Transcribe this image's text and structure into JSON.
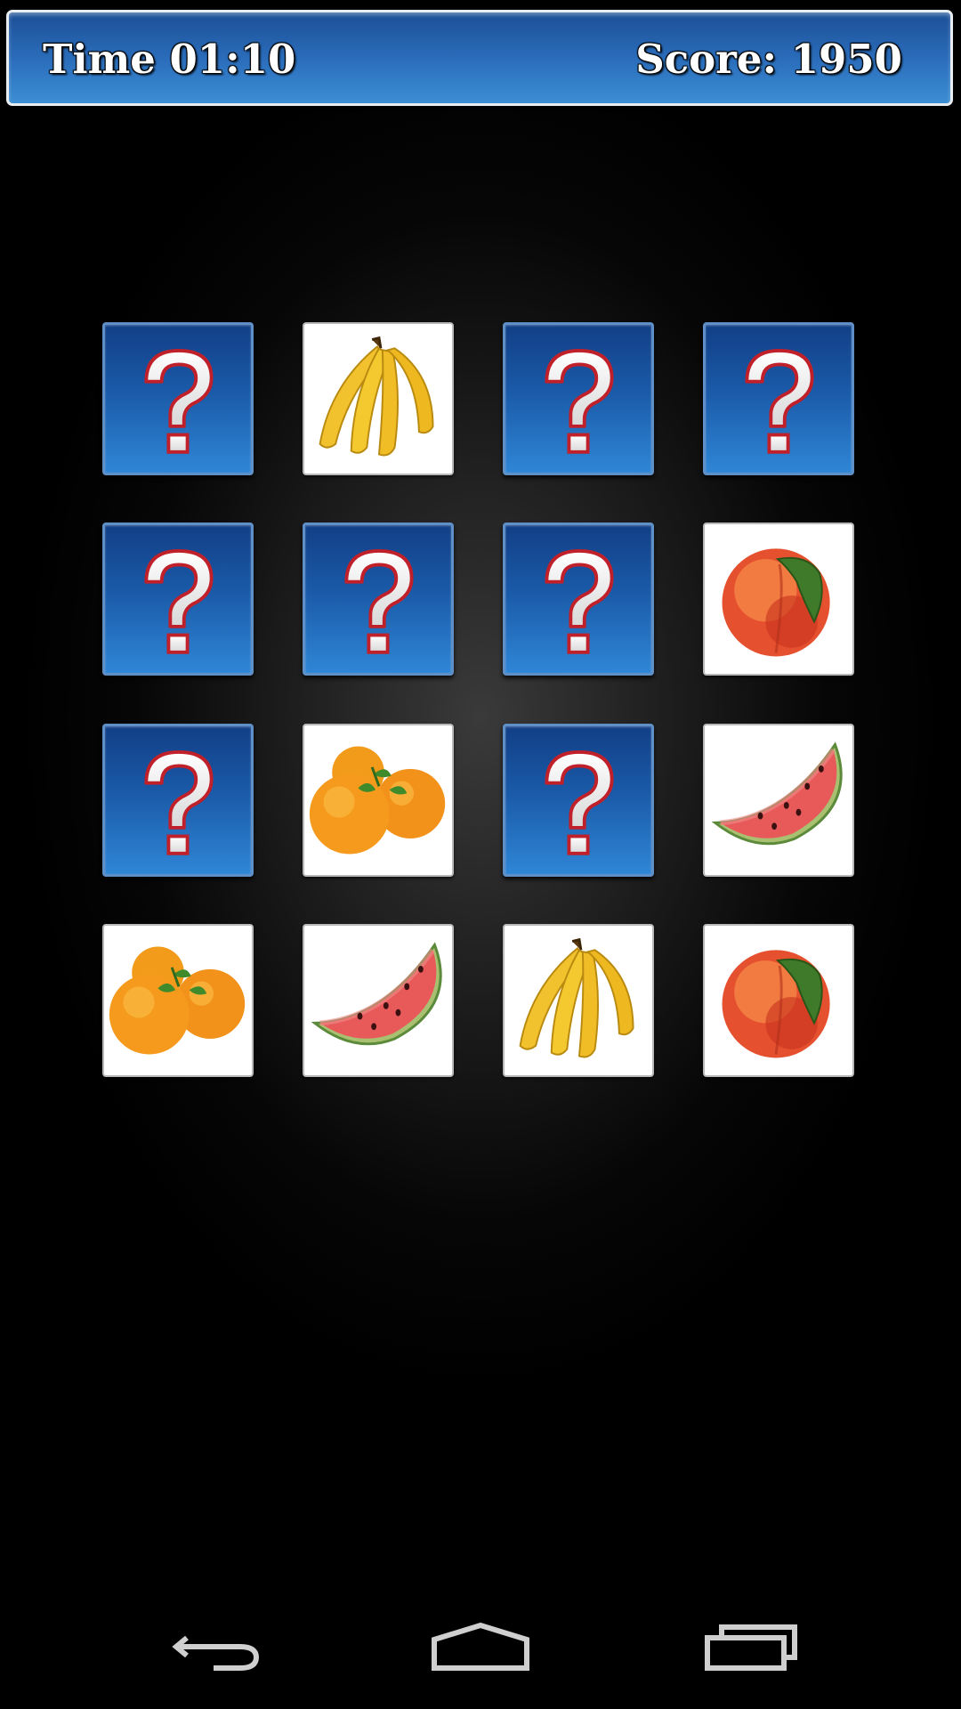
{
  "hud": {
    "time_text": "Time 01:10",
    "score_text": "Score: 1950"
  },
  "board": {
    "columns": 4,
    "rows": 4,
    "cards": [
      {
        "state": "hidden",
        "fruit": "question-mark"
      },
      {
        "state": "revealed",
        "fruit": "banana"
      },
      {
        "state": "hidden",
        "fruit": "question-mark"
      },
      {
        "state": "hidden",
        "fruit": "question-mark"
      },
      {
        "state": "hidden",
        "fruit": "question-mark"
      },
      {
        "state": "hidden",
        "fruit": "question-mark"
      },
      {
        "state": "hidden",
        "fruit": "question-mark"
      },
      {
        "state": "revealed",
        "fruit": "peach"
      },
      {
        "state": "hidden",
        "fruit": "question-mark"
      },
      {
        "state": "revealed",
        "fruit": "orange"
      },
      {
        "state": "hidden",
        "fruit": "question-mark"
      },
      {
        "state": "revealed",
        "fruit": "watermelon"
      },
      {
        "state": "revealed",
        "fruit": "orange"
      },
      {
        "state": "revealed",
        "fruit": "watermelon"
      },
      {
        "state": "revealed",
        "fruit": "banana"
      },
      {
        "state": "revealed",
        "fruit": "peach"
      }
    ]
  },
  "navigation": {
    "buttons": [
      "back-icon",
      "home-icon",
      "recent-apps-icon"
    ]
  },
  "colors": {
    "hud_blue": "#2a6cba",
    "card_back_blue": "#1a5aa8",
    "question_mark_outline": "#c0202a",
    "background": "#000000"
  }
}
